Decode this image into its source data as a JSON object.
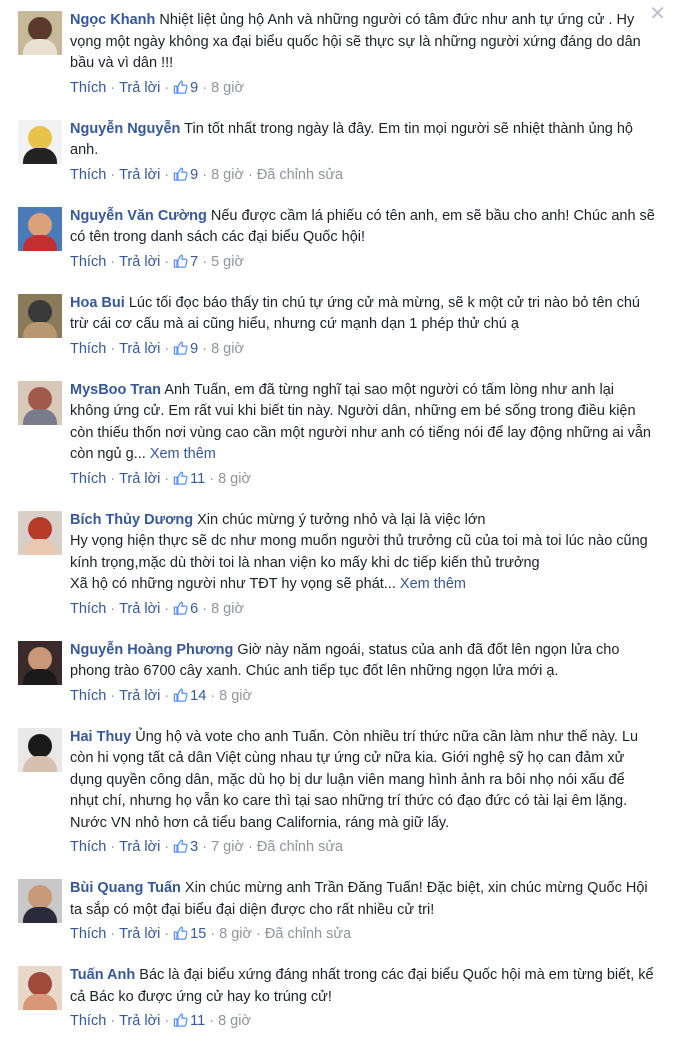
{
  "labels": {
    "like": "Thích",
    "reply": "Trả lời",
    "dot": "·",
    "edited": "Đã chỉnh sửa",
    "see_more": "Xem thêm",
    "close": "✕"
  },
  "comments": [
    {
      "name": "Ngọc Khanh",
      "text": "Nhiệt liệt ủng hộ Anh và những người có tâm đức như anh tự ứng cử . Hy vọng một ngày không xa đại biểu quốc hội sẽ thực sự là những người xứng đáng do dân bầu và vì dân !!!",
      "likes": "9",
      "time": "8 giờ",
      "avatar_colors": [
        "#c8b89a",
        "#5a3a2a",
        "#e8e0d0"
      ]
    },
    {
      "name": "Nguyễn Nguyễn",
      "text": "Tin tốt nhất trong ngày là đây. Em tin mọi người sẽ nhiệt thành ủng hộ anh.",
      "likes": "9",
      "time": "8 giờ",
      "edited": true,
      "avatar_colors": [
        "#f2f2f2",
        "#e8c34a",
        "#222222"
      ]
    },
    {
      "name": "Nguyễn Văn Cường",
      "text": "Nếu được cầm lá phiếu có tên anh, em sẽ bầu cho anh! Chúc anh sẽ có tên trong danh sách các đại biểu Quốc hội!",
      "likes": "7",
      "time": "5 giờ",
      "avatar_colors": [
        "#4a7ab8",
        "#d9a07a",
        "#c23030"
      ]
    },
    {
      "name": "Hoa Bui",
      "text": "Lúc tối đọc báo thấy tin chú tự ứng cử mà mừng, sẽ k một cử tri nào bỏ tên chú trừ cái cơ cấu mà ai cũng hiểu, nhưng cứ mạnh dạn 1 phép thử chú ạ",
      "likes": "9",
      "time": "8 giờ",
      "avatar_colors": [
        "#8a7a5a",
        "#3a3a3a",
        "#b89870"
      ]
    },
    {
      "name": "MysBoo Tran",
      "text": "Anh Tuấn, em đã từng nghĩ tại sao một người có tấm lòng như anh lại không ứng cử. Em rất vui khi biết tin này. Người dân, những em bé sống trong điều kiện còn thiếu thốn nơi vùng cao cần một người như anh có tiếng nói để lay động những ai vẫn còn ngủ g...",
      "see_more": true,
      "likes": "11",
      "time": "8 giờ",
      "avatar_colors": [
        "#d8c8b8",
        "#a05a4a",
        "#7a7a8a"
      ]
    },
    {
      "name": "Bích Thủy Dương",
      "text": "Xin chúc mừng ý tưởng nhỏ và lại là việc lớn\nHy vọng hiện thực sẽ dc như mong muốn người thủ trưởng cũ của toi mà toi lúc nào cũng kính trọng,mặc dù thời toi là nhan viện ko mấy khi dc tiếp kiến thủ trưởng\nXã hộ có những người như TĐT hy vọng sẽ phát...",
      "see_more": true,
      "likes": "6",
      "time": "8 giờ",
      "avatar_colors": [
        "#d8d0c8",
        "#b83a2a",
        "#e8c8b0"
      ]
    },
    {
      "name": "Nguyễn Hoàng Phương",
      "text": "Giờ này năm ngoái, status của anh đã đốt lên ngọn lửa cho phong trào 6700 cây xanh. Chúc anh tiếp tục đốt lên những ngọn lửa mới ạ.",
      "likes": "14",
      "time": "8 giờ",
      "avatar_colors": [
        "#3a2a2a",
        "#c89878",
        "#1a1a1a"
      ]
    },
    {
      "name": "Hai Thuy",
      "text": "Ủng hộ và vote cho anh Tuấn. Còn nhiều trí thức nữa cần làm như thế này. Lu còn hi vọng tất cả dân Việt cùng nhau tự ứng cử nữa kia. Giới nghệ sỹ họ can đảm xử dụng quyền công dân, mặc dù họ bị dư luận viên mang hình ảnh ra bôi nhọ nói xấu để nhụt chí, nhưng họ vẫn ko care thì tại sao những trí thức có đạo đức có tài lại êm lặng. Nước VN nhỏ hơn cả tiểu bang California, ráng mà giữ lấy.",
      "likes": "3",
      "time": "7 giờ",
      "edited": true,
      "avatar_colors": [
        "#e8e8e8",
        "#1a1a1a",
        "#d8c0b0"
      ]
    },
    {
      "name": "Bùi Quang Tuấn",
      "text": "Xin chúc mừng anh Trần Đăng Tuấn! Đặc biệt, xin chúc mừng Quốc Hội ta sắp có một đại biểu đại diện được cho rất nhiều cử tri!",
      "likes": "15",
      "time": "8 giờ",
      "edited": true,
      "avatar_colors": [
        "#c8c8c8",
        "#c89878",
        "#2a2a3a"
      ]
    },
    {
      "name": "Tuấn Anh",
      "text": "Bác là đại biểu xứng đáng nhất trong các đại biểu Quốc hội mà em từng biết, kể cả Bác ko được ứng cử hay ko trúng cử!",
      "likes": "11",
      "time": "8 giờ",
      "avatar_colors": [
        "#e8d8c8",
        "#a04a3a",
        "#d89878"
      ]
    }
  ]
}
